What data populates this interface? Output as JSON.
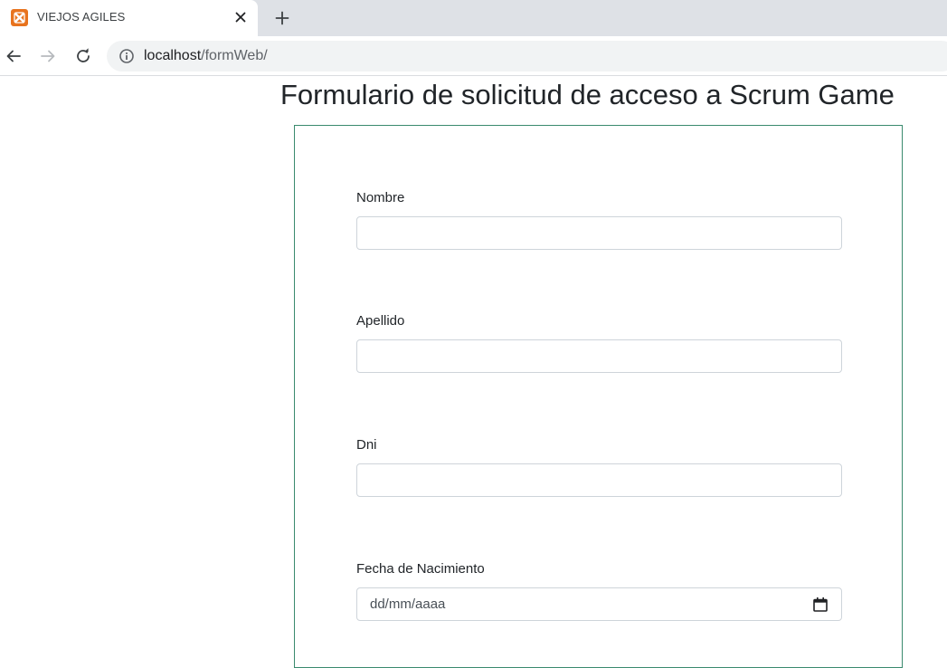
{
  "browser": {
    "tab": {
      "title": "VIEJOS AGILES",
      "favicon": "xampp-icon"
    },
    "address_bar": {
      "host": "localhost",
      "path": "/formWeb/"
    }
  },
  "page": {
    "title": "Formulario de solicitud de acceso a Scrum Game",
    "form": {
      "fields": [
        {
          "label": "Nombre",
          "value": ""
        },
        {
          "label": "Apellido",
          "value": ""
        },
        {
          "label": "Dni",
          "value": ""
        },
        {
          "label": "Fecha de Nacimiento",
          "placeholder": "dd/mm/aaaa"
        }
      ]
    }
  },
  "colors": {
    "form_border": "#3a8a6e",
    "favicon": "#e8731e",
    "tabstrip": "#dee1e6"
  }
}
